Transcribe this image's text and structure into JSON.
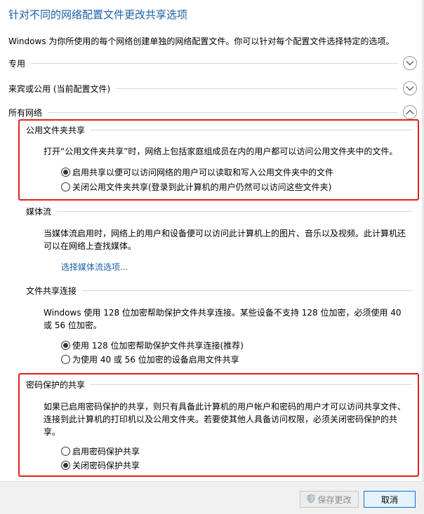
{
  "page": {
    "title": "针对不同的网络配置文件更改共享选项",
    "subtitle": "Windows 为你所使用的每个网络创建单独的网络配置文件。你可以针对每个配置文件选择特定的选项。"
  },
  "profiles": {
    "private": "专用",
    "guest_public": "来宾或公用 (当前配置文件)",
    "all_networks": "所有网络"
  },
  "public_folder": {
    "heading": "公用文件夹共享",
    "description": "打开“公用文件夹共享”时，网络上包括家庭组成员在内的用户都可以访问公用文件夹中的文件。",
    "options": [
      {
        "label": "启用共享以便可以访问网络的用户可以读取和写入公用文件夹中的文件",
        "checked": true
      },
      {
        "label": "关闭公用文件夹共享(登录到此计算机的用户仍然可以访问这些文件夹)",
        "checked": false
      }
    ]
  },
  "media": {
    "heading": "媒体流",
    "description": "当媒体流启用时，网络上的用户和设备便可以访问此计算机上的图片、音乐以及视频。此计算机还可以在网络上查找媒体。",
    "link": "选择媒体流选项..."
  },
  "file_sharing": {
    "heading": "文件共享连接",
    "description": "Windows 使用 128 位加密帮助保护文件共享连接。某些设备不支持 128 位加密，必须使用 40 或 56 位加密。",
    "options": [
      {
        "label": "使用 128 位加密帮助保护文件共享连接(推荐)",
        "checked": true
      },
      {
        "label": "为使用 40 或 56 位加密的设备启用文件共享",
        "checked": false
      }
    ]
  },
  "password": {
    "heading": "密码保护的共享",
    "description": "如果已启用密码保护的共享，则只有具备此计算机的用户帐户和密码的用户才可以访问共享文件、连接到此计算机的打印机以及公用文件夹。若要使其他人具备访问权限，必须关闭密码保护的共享。",
    "options": [
      {
        "label": "启用密码保护共享",
        "checked": false
      },
      {
        "label": "关闭密码保护共享",
        "checked": true
      }
    ]
  },
  "footer": {
    "save_label": "保存更改",
    "cancel_label": "取消"
  },
  "colors": {
    "title_blue": "#1a5fa8",
    "highlight_red": "#e02020"
  },
  "icons": {
    "expand": "chevron-down-icon",
    "collapse": "chevron-up-icon",
    "uac": "shield-icon"
  }
}
